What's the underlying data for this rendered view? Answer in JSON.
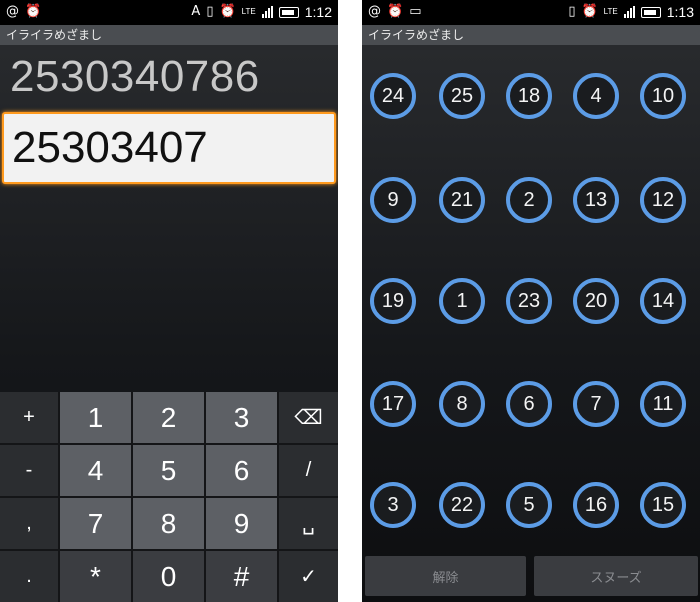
{
  "left": {
    "status": {
      "time": "1:12",
      "at": "@",
      "letter": "A",
      "lte": "LTE"
    },
    "app_title": "イライラめざまし",
    "answer": "2530340786",
    "input_value": "25303407",
    "keys": {
      "plus": "+",
      "minus": "-",
      "comma": ",",
      "dot": ".",
      "k1": "1",
      "k2": "2",
      "k3": "3",
      "k4": "4",
      "k5": "5",
      "k6": "6",
      "k7": "7",
      "k8": "8",
      "k9": "9",
      "star": "*",
      "k0": "0",
      "hash": "#",
      "slash": "/",
      "backspace_icon": "⌫",
      "space_icon": "␣",
      "done_icon": "✓"
    }
  },
  "right": {
    "status": {
      "time": "1:13",
      "at": "@",
      "lte": "LTE"
    },
    "app_title": "イライラめざまし",
    "grid": [
      [
        "24",
        "25",
        "18",
        "4",
        "10"
      ],
      [
        "9",
        "21",
        "2",
        "13",
        "12"
      ],
      [
        "19",
        "1",
        "23",
        "20",
        "14"
      ],
      [
        "17",
        "8",
        "6",
        "7",
        "11"
      ],
      [
        "3",
        "22",
        "5",
        "16",
        "15"
      ]
    ],
    "dismiss_label": "解除",
    "snooze_label": "スヌーズ"
  },
  "colors": {
    "accent_orange": "#ff9a1e",
    "ring_blue": "#5c9ce6"
  }
}
